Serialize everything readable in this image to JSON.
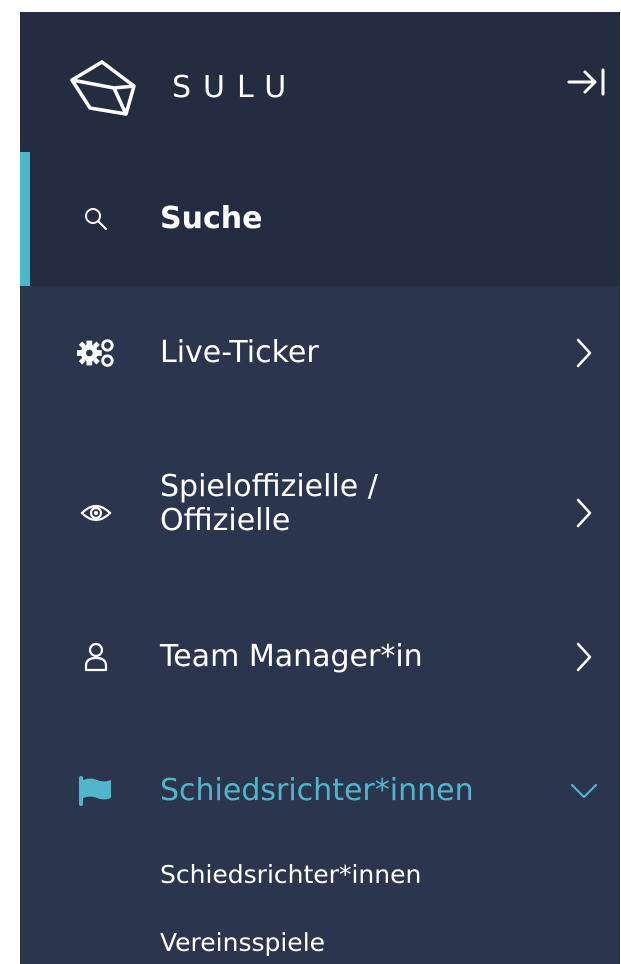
{
  "app": {
    "logo_text": "SULU"
  },
  "colors": {
    "accent": "#52b6ca",
    "sidebar_bg": "#2b354e",
    "header_bg": "#232c41"
  },
  "nav": {
    "search_label": "Suche",
    "items": [
      {
        "label": "Live-Ticker",
        "icon": "gears-icon"
      },
      {
        "label_line1": "Spieloffizielle /",
        "label_line2": "Offizielle",
        "icon": "eye-icon"
      },
      {
        "label": "Team Manager*in",
        "icon": "user-icon"
      },
      {
        "label": "Schiedsrichter*innen",
        "icon": "flag-icon",
        "expanded": true,
        "subitems": [
          {
            "label": "Schiedsrichter*innen"
          },
          {
            "label": "Vereinsspiele"
          }
        ]
      }
    ]
  }
}
